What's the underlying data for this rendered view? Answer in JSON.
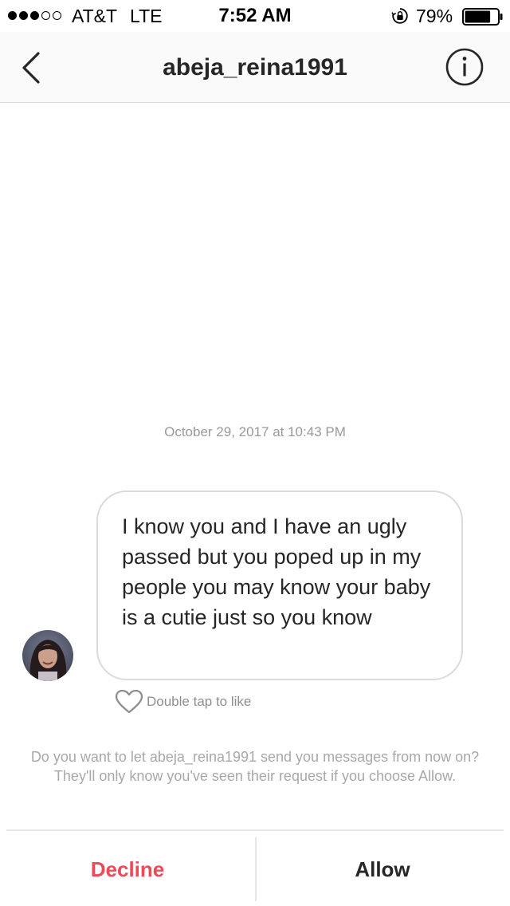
{
  "status_bar": {
    "signal_dots_filled": 3,
    "signal_dots_total": 5,
    "carrier": "AT&T",
    "network": "LTE",
    "time": "7:52 AM",
    "battery_percent": "79%",
    "battery_level": 0.79
  },
  "header": {
    "back_icon": "chevron-left-icon",
    "username": "abeja_reina1991",
    "info_icon": "info-circle-icon"
  },
  "thread": {
    "timestamp": "October 29, 2017 at 10:43 PM",
    "message": {
      "text": "I know you and I have an ugly passed but you poped up in my people you may know your baby is a cutie just so you know"
    },
    "like_hint": "Double tap to like"
  },
  "request": {
    "prompt": "Do you want to let abeja_reina1991 send you messages from now on? They'll only know you've seen their request if you choose Allow.",
    "decline_label": "Decline",
    "allow_label": "Allow"
  },
  "colors": {
    "decline": "#ed4956",
    "text": "#262626",
    "muted": "#999999",
    "border": "#dbdbdb",
    "header_bg": "#fafafa"
  }
}
